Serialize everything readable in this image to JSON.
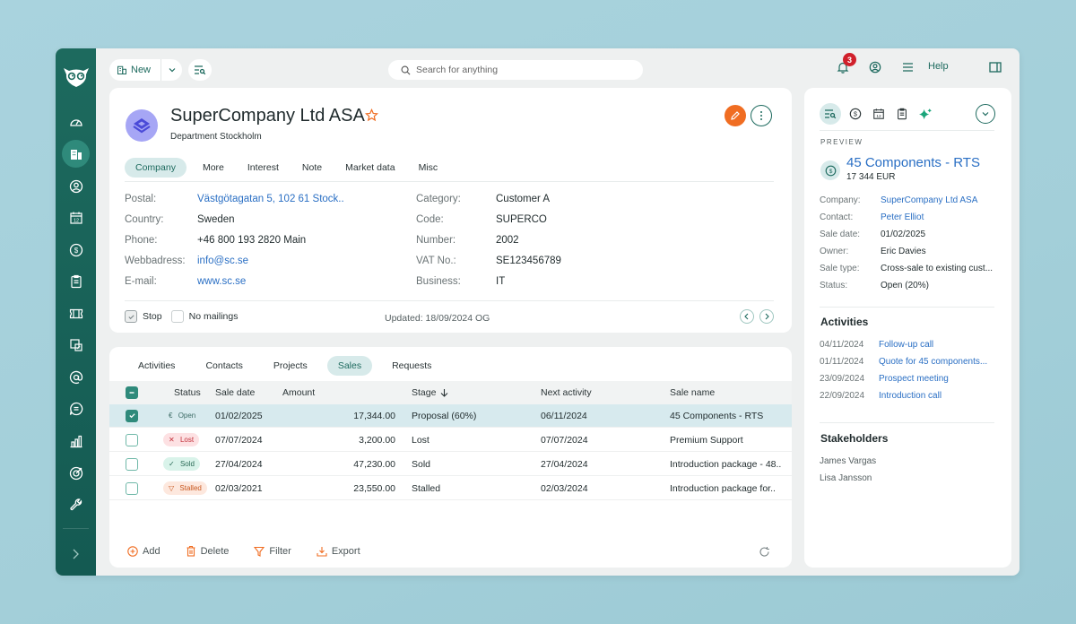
{
  "topbar": {
    "new_label": "New",
    "search_placeholder": "Search for anything",
    "notification_count": "3",
    "help_label": "Help"
  },
  "sidebar": {
    "items": [
      {
        "name": "dashboard",
        "icon": "gauge-icon",
        "active": false
      },
      {
        "name": "company",
        "icon": "building-icon",
        "active": true
      },
      {
        "name": "contacts",
        "icon": "person-icon",
        "active": false
      },
      {
        "name": "diary",
        "icon": "calendar-icon",
        "active": false
      },
      {
        "name": "sales",
        "icon": "dollar-icon",
        "active": false
      },
      {
        "name": "projects",
        "icon": "clipboard-icon",
        "active": false
      },
      {
        "name": "tickets",
        "icon": "ticket-icon",
        "active": false
      },
      {
        "name": "selections",
        "icon": "selection-icon",
        "active": false
      },
      {
        "name": "mail",
        "icon": "at-icon",
        "active": false
      },
      {
        "name": "chat",
        "icon": "chat-icon",
        "active": false
      },
      {
        "name": "reports",
        "icon": "bar-chart-icon",
        "active": false
      },
      {
        "name": "targets",
        "icon": "target-icon",
        "active": false
      },
      {
        "name": "settings",
        "icon": "wrench-icon",
        "active": false
      }
    ]
  },
  "company": {
    "name": "SuperCompany Ltd ASA",
    "department": "Department Stockholm",
    "tabs": [
      "Company",
      "More",
      "Interest",
      "Note",
      "Market data",
      "Misc"
    ],
    "active_tab": "Company",
    "left_fields": [
      {
        "label": "Postal:",
        "value": "Västgötagatan 5, 102 61 Stock..",
        "link": true
      },
      {
        "label": "Country:",
        "value": "Sweden",
        "link": false
      },
      {
        "label": "Phone:",
        "value": "+46 800 193 2820  Main",
        "link": false
      },
      {
        "label": "Webbadress:",
        "value": "info@sc.se",
        "link": true
      },
      {
        "label": "E-mail:",
        "value": "www.sc.se",
        "link": true
      }
    ],
    "right_fields": [
      {
        "label": "Category:",
        "value": "Customer A"
      },
      {
        "label": "Code:",
        "value": "SUPERCO"
      },
      {
        "label": "Number:",
        "value": "2002"
      },
      {
        "label": "VAT No.:",
        "value": "SE123456789"
      },
      {
        "label": "Business:",
        "value": "IT"
      }
    ],
    "stop_label": "Stop",
    "stop_checked": true,
    "no_mailings_label": "No mailings",
    "no_mailings_checked": false,
    "updated": "Updated: 18/09/2024 OG"
  },
  "sales_section": {
    "tabs": [
      "Activities",
      "Contacts",
      "Projects",
      "Sales",
      "Requests"
    ],
    "active_tab": "Sales",
    "columns": [
      "Status",
      "Sale date",
      "Amount",
      "Stage",
      "Next activity",
      "Sale name"
    ],
    "sort_column": "Stage",
    "rows": [
      {
        "selected": true,
        "status": "Open",
        "status_icon": "€",
        "status_kind": "open",
        "sale_date": "01/02/2025",
        "amount": "17,344.00",
        "stage": "Proposal (60%)",
        "next_activity": "06/11/2024",
        "sale_name": "45 Components - RTS"
      },
      {
        "selected": false,
        "status": "Lost",
        "status_icon": "✕",
        "status_kind": "lost",
        "sale_date": "07/07/2024",
        "amount": "3,200.00",
        "stage": "Lost",
        "next_activity": "07/07/2024",
        "sale_name": "Premium Support"
      },
      {
        "selected": false,
        "status": "Sold",
        "status_icon": "✓",
        "status_kind": "sold",
        "sale_date": "27/04/2024",
        "amount": "47,230.00",
        "stage": "Sold",
        "next_activity": "27/04/2024",
        "sale_name": "Introduction package - 48.."
      },
      {
        "selected": false,
        "status": "Stalled",
        "status_icon": "▽",
        "status_kind": "stalled",
        "sale_date": "02/03/2021",
        "amount": "23,550.00",
        "stage": "Stalled",
        "next_activity": "02/03/2024",
        "sale_name": "Introduction package for.."
      }
    ],
    "toolbar": {
      "add": "Add",
      "delete": "Delete",
      "filter": "Filter",
      "export": "Export"
    }
  },
  "preview": {
    "section_label": "PREVIEW",
    "title": "45 Components - RTS",
    "amount": "17 344 EUR",
    "fields": [
      {
        "label": "Company:",
        "value": "SuperCompany Ltd ASA",
        "link": true
      },
      {
        "label": "Contact:",
        "value": "Peter Elliot",
        "link": true
      },
      {
        "label": "Sale date:",
        "value": "01/02/2025",
        "link": false
      },
      {
        "label": "Owner:",
        "value": "Eric Davies",
        "link": false
      },
      {
        "label": "Sale type:",
        "value": "Cross-sale to existing cust...",
        "link": false
      },
      {
        "label": "Status:",
        "value": "Open (20%)",
        "link": false
      }
    ],
    "activities_heading": "Activities",
    "activities": [
      {
        "date": "04/11/2024",
        "title": "Follow-up call"
      },
      {
        "date": "01/11/2024",
        "title": "Quote for 45 components..."
      },
      {
        "date": "23/09/2024",
        "title": "Prospect meeting"
      },
      {
        "date": "22/09/2024",
        "title": "Introduction call"
      }
    ],
    "stakeholders_heading": "Stakeholders",
    "stakeholders": [
      "James Vargas",
      "Lisa Jansson"
    ]
  }
}
